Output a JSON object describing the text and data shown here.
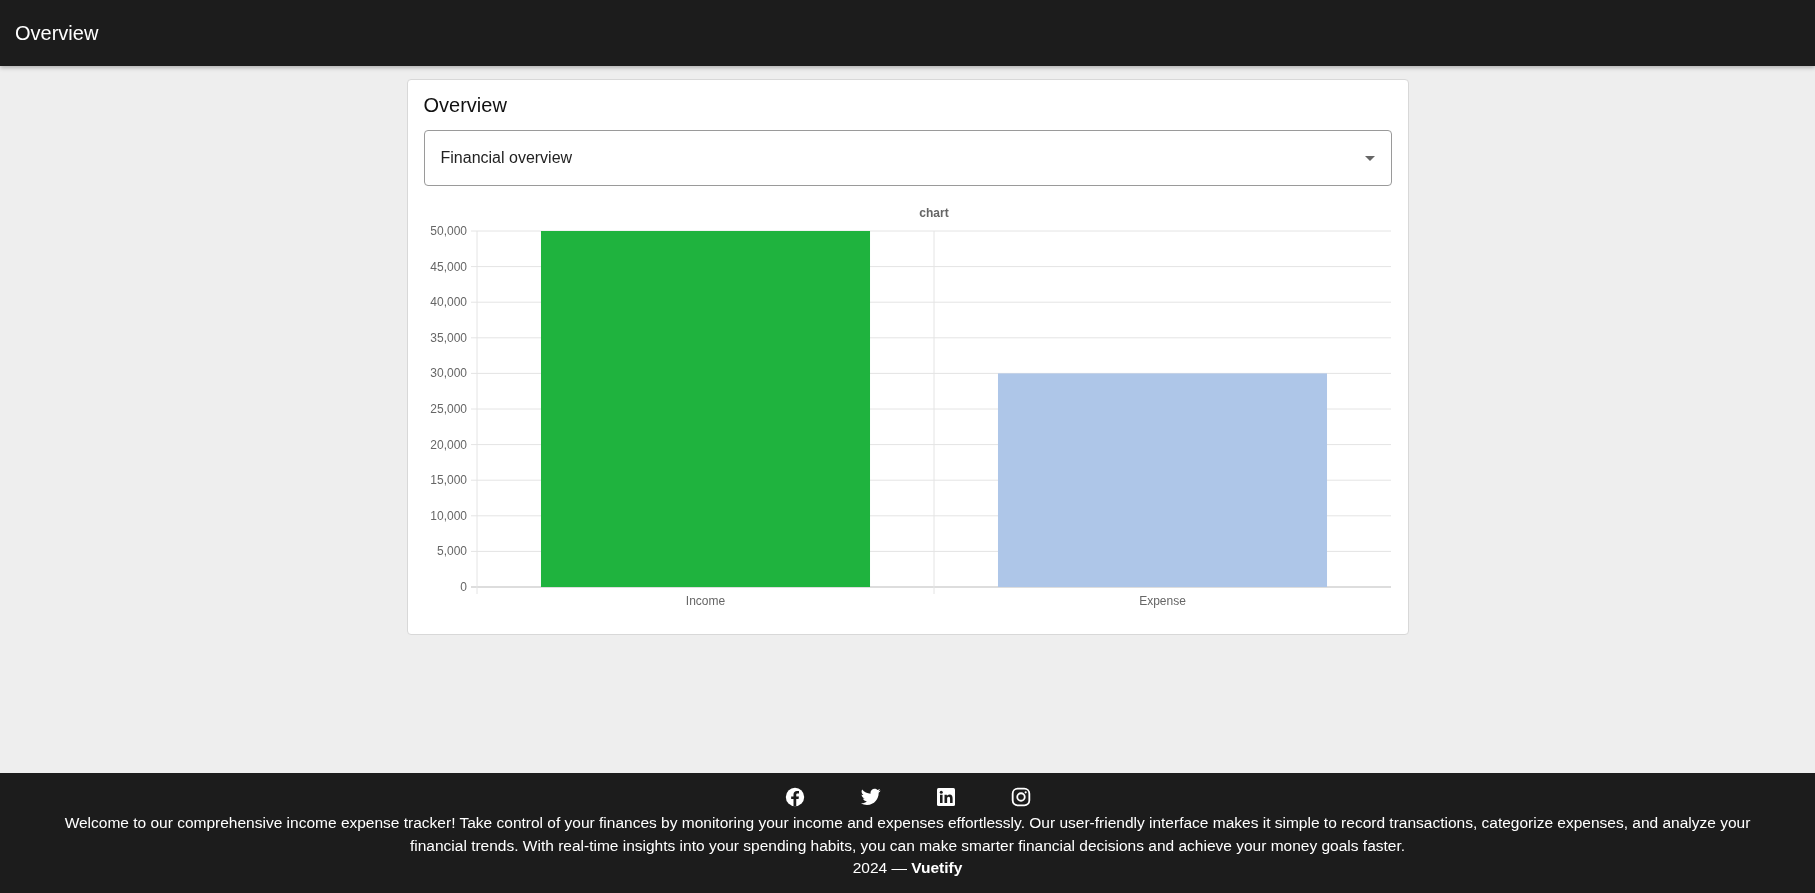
{
  "app_bar": {
    "title": "Overview"
  },
  "card": {
    "title": "Overview",
    "select": {
      "value": "Financial overview"
    },
    "chart_data": {
      "type": "bar",
      "title": "chart",
      "categories": [
        "Income",
        "Expense"
      ],
      "values": [
        50000,
        30000
      ],
      "colors": [
        "#1fb33e",
        "#aec6e8"
      ],
      "grid": true,
      "ylim": [
        0,
        50000
      ],
      "yticks": [
        {
          "value": 0,
          "label": "0"
        },
        {
          "value": 5000,
          "label": "5,000"
        },
        {
          "value": 10000,
          "label": "10,000"
        },
        {
          "value": 15000,
          "label": "15,000"
        },
        {
          "value": 20000,
          "label": "20,000"
        },
        {
          "value": 25000,
          "label": "25,000"
        },
        {
          "value": 30000,
          "label": "30,000"
        },
        {
          "value": 35000,
          "label": "35,000"
        },
        {
          "value": 40000,
          "label": "40,000"
        },
        {
          "value": 45000,
          "label": "45,000"
        },
        {
          "value": 50000,
          "label": "50,000"
        }
      ]
    }
  },
  "footer": {
    "social_icons": [
      {
        "kind": "facebook"
      },
      {
        "kind": "twitter"
      },
      {
        "kind": "linkedin"
      },
      {
        "kind": "instagram"
      }
    ],
    "text": "Welcome to our comprehensive income expense tracker! Take control of your finances by monitoring your income and expenses effortlessly. Our user-friendly interface makes it simple to record transactions, categorize expenses, and analyze your financial trends. With real-time insights into your spending habits, you can make smarter financial decisions and achieve your money goals faster.",
    "copyright": "2024 — **Vuetify**"
  }
}
